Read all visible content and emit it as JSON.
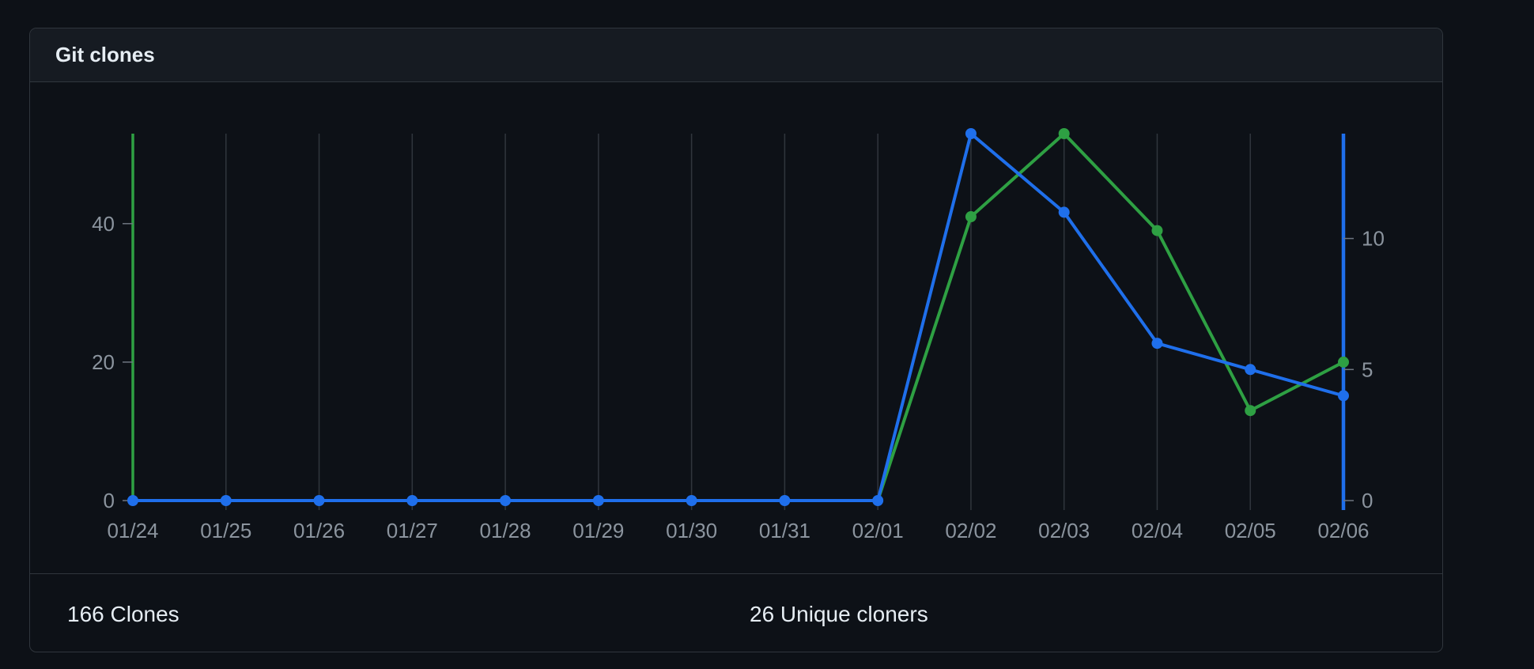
{
  "panel": {
    "title": "Git clones"
  },
  "footer": {
    "clones_label": "166 Clones",
    "uniques_label": "26 Unique cloners"
  },
  "colors": {
    "clones": "#2ea043",
    "uniques": "#1f6feb",
    "grid": "#30363d",
    "tick_text": "#8b949e"
  },
  "chart_data": {
    "type": "line",
    "title": "",
    "xlabel": "",
    "categories": [
      "01/24",
      "01/25",
      "01/26",
      "01/27",
      "01/28",
      "01/29",
      "01/30",
      "01/31",
      "02/01",
      "02/02",
      "02/03",
      "02/04",
      "02/05",
      "02/06"
    ],
    "series": [
      {
        "name": "Clones",
        "axis": "left",
        "color": "#2ea043",
        "values": [
          0,
          0,
          0,
          0,
          0,
          0,
          0,
          0,
          0,
          41,
          53,
          39,
          13,
          20
        ]
      },
      {
        "name": "Unique cloners",
        "axis": "right",
        "color": "#1f6feb",
        "values": [
          0,
          0,
          0,
          0,
          0,
          0,
          0,
          0,
          0,
          14,
          11,
          6,
          5,
          4
        ]
      }
    ],
    "y_left": {
      "ylim": [
        0,
        53
      ],
      "ticks": [
        0,
        20,
        40
      ],
      "label": ""
    },
    "y_right": {
      "ylim": [
        0,
        14
      ],
      "ticks": [
        0,
        5,
        10
      ],
      "label": ""
    },
    "grid": "vertical",
    "legend": "none"
  }
}
